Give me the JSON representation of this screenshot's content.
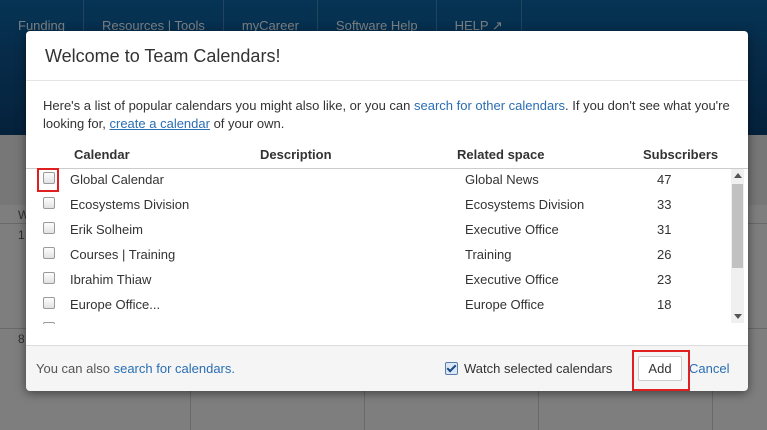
{
  "background": {
    "nav": [
      "Funding",
      "Resources | Tools",
      "myCareer",
      "Software Help",
      "HELP ↗"
    ],
    "grid_labels": [
      "W",
      "1",
      "8"
    ]
  },
  "dialog": {
    "title": "Welcome to Team Calendars!",
    "intro": {
      "part1": "Here's a list of popular calendars you might also like, or you can ",
      "link1": "search for other calendars",
      "part2": ". If you don't see what you're looking for, ",
      "link2": "create a calendar",
      "part3": " of your own."
    },
    "columns": {
      "calendar": "Calendar",
      "description": "Description",
      "related_space": "Related space",
      "subscribers": "Subscribers"
    },
    "rows": [
      {
        "calendar": "Global Calendar",
        "description": "",
        "space": "Global News",
        "subscribers": "47"
      },
      {
        "calendar": "Ecosystems Division",
        "description": "",
        "space": "Ecosystems Division",
        "subscribers": "33"
      },
      {
        "calendar": "Erik Solheim",
        "description": "",
        "space": "Executive Office",
        "subscribers": "31"
      },
      {
        "calendar": "Courses | Training",
        "description": "",
        "space": "Training",
        "subscribers": "26"
      },
      {
        "calendar": "Ibrahim Thiaw",
        "description": "",
        "space": "Executive Office",
        "subscribers": "23"
      },
      {
        "calendar": "Europe Office...",
        "description": "",
        "space": "Europe Office",
        "subscribers": "18"
      }
    ],
    "footer": {
      "text": "You can also ",
      "link": "search for calendars.",
      "watch_label": "Watch selected calendars",
      "watch_checked": true,
      "add_label": "Add",
      "cancel_label": "Cancel"
    }
  },
  "colors": {
    "link": "#2a6eb3",
    "highlight": "#e02020"
  }
}
